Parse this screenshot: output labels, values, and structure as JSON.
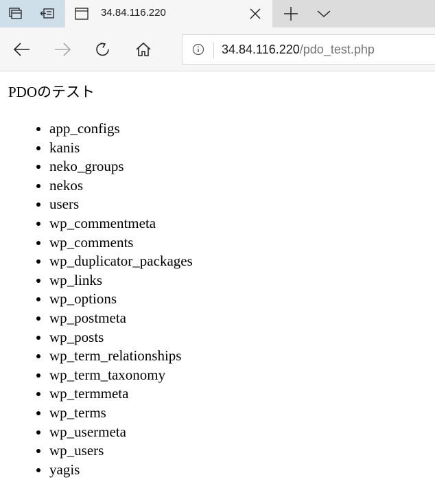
{
  "browser": {
    "tab": {
      "title": "34.84.116.220"
    },
    "address": {
      "host": "34.84.116.220",
      "path": "/pdo_test.php"
    }
  },
  "page": {
    "heading": "PDOのテスト",
    "tables": [
      "app_configs",
      "kanis",
      "neko_groups",
      "nekos",
      "users",
      "wp_commentmeta",
      "wp_comments",
      "wp_duplicator_packages",
      "wp_links",
      "wp_options",
      "wp_postmeta",
      "wp_posts",
      "wp_term_relationships",
      "wp_term_taxonomy",
      "wp_termmeta",
      "wp_terms",
      "wp_usermeta",
      "wp_users",
      "yagis"
    ]
  }
}
